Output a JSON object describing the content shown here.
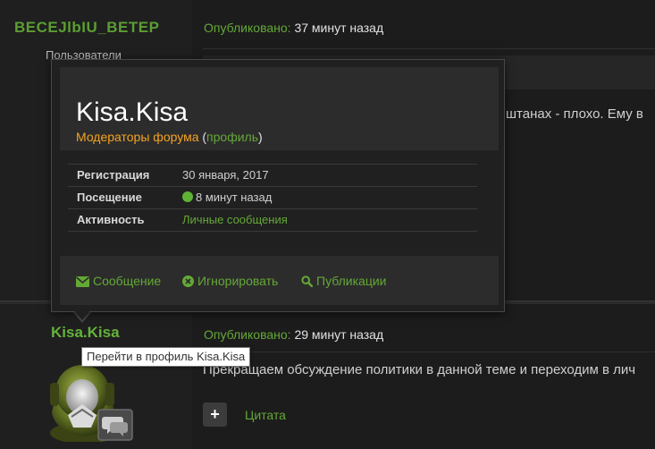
{
  "post1": {
    "author": "BECEJlbIU_BETEP",
    "group": "Пользователи",
    "published_label": "Опубликовано:",
    "published_time": "37 минут назад",
    "text": "штанах - плохо. Ему в"
  },
  "post2": {
    "author": "Kisa.Kisa",
    "published_label": "Опубликовано:",
    "published_time": "29 минут назад",
    "text": "Прекращаем обсуждение политики в данной теме и переходим в лич",
    "quote_label": "Цитата",
    "plus_label": "+"
  },
  "tooltip": {
    "text": "Перейти в профиль Kisa.Kisa"
  },
  "hovercard": {
    "name": "Kisa.Kisa",
    "group": "Модераторы форума",
    "paren_open": " (",
    "profile_link": "профиль",
    "paren_close": ")",
    "rows": [
      {
        "key": "Регистрация",
        "value": "30 января, 2017"
      },
      {
        "key": "Посещение",
        "value": "8 минут назад"
      },
      {
        "key": "Активность",
        "value": "Личные сообщения"
      }
    ],
    "actions": [
      {
        "label": "Сообщение",
        "icon": "envelope-icon"
      },
      {
        "label": "Игнорировать",
        "icon": "ignore-icon"
      },
      {
        "label": "Публикации",
        "icon": "search-icon"
      }
    ]
  },
  "colors": {
    "accent_green": "#64a836",
    "group_orange": "#f4a322",
    "background": "#1c1c1c"
  }
}
